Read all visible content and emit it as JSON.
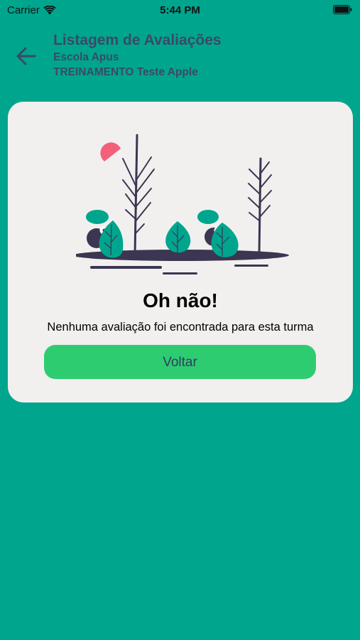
{
  "status_bar": {
    "carrier": "Carrier",
    "time": "5:44 PM",
    "wifi_icon": "wifi-icon",
    "battery_icon": "battery-icon"
  },
  "header": {
    "back_icon": "arrow-left-icon",
    "title": "Listagem de Avaliações",
    "school": "Escola Apus",
    "class_name": "TREINAMENTO Teste Apple"
  },
  "empty_state": {
    "illustration": "trees-and-creatures-illustration",
    "heading": "Oh não!",
    "message": "Nenhuma avaliação foi encontrada para esta turma",
    "button_label": "Voltar"
  },
  "colors": {
    "background": "#00A58E",
    "card": "#F2F0EE",
    "button": "#2ECC71",
    "header_text": "#3A4A66",
    "leaf": "#00A58E",
    "sun": "#F2607A",
    "dark": "#3B3652"
  }
}
